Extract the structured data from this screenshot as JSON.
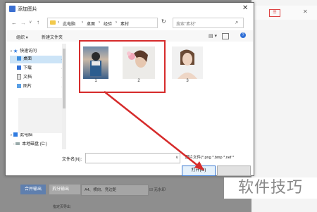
{
  "dialog": {
    "title": "添加图片",
    "close_glyph": "✕"
  },
  "nav": {
    "back_glyph": "←",
    "forward_glyph": "→",
    "dropdown_glyph": "∨",
    "up_glyph": "↑",
    "refresh_glyph": "↻"
  },
  "address": {
    "crumbs": [
      "此电脑",
      "桌面",
      "经验",
      "素材"
    ],
    "sep": "›"
  },
  "search": {
    "placeholder": "搜索\"素材\"",
    "icon": "search-icon"
  },
  "toolbar": {
    "organize": "组织 ▾",
    "new_folder": "新建文件夹",
    "help": "?"
  },
  "sidebar": {
    "items": [
      {
        "label": "快速访问",
        "icon": "star-icon",
        "pinned": false
      },
      {
        "label": "桌面",
        "icon": "desktop-icon",
        "pinned": true,
        "selected": true
      },
      {
        "label": "下载",
        "icon": "download-icon",
        "pinned": true
      },
      {
        "label": "文档",
        "icon": "document-icon",
        "pinned": true
      },
      {
        "label": "图片",
        "icon": "picture-icon",
        "pinned": true
      },
      {
        "label": "此电脑",
        "icon": "computer-icon",
        "pinned": false
      },
      {
        "label": "本地磁盘 (C:)",
        "icon": "disk-icon",
        "pinned": false
      }
    ],
    "pin_glyph": "⊥"
  },
  "files": [
    {
      "name": "1"
    },
    {
      "name": "2"
    },
    {
      "name": "3"
    }
  ],
  "footer": {
    "filename_label": "文件名(N):",
    "filename_value": "",
    "filter_label": "图片文件(*.png *.bmp *.nef *",
    "open_button": "打开(O)",
    "cancel_button": ""
  },
  "background_app": {
    "merge_button": "合并输出",
    "split_button": "拆分输出",
    "paper_select": "A4、横向、竞边距",
    "option": "无水印",
    "bottom_text": "指定页导出"
  },
  "watermark": "软件技巧",
  "colors": {
    "highlight": "#d62b2b",
    "accent": "#3b78d0"
  }
}
